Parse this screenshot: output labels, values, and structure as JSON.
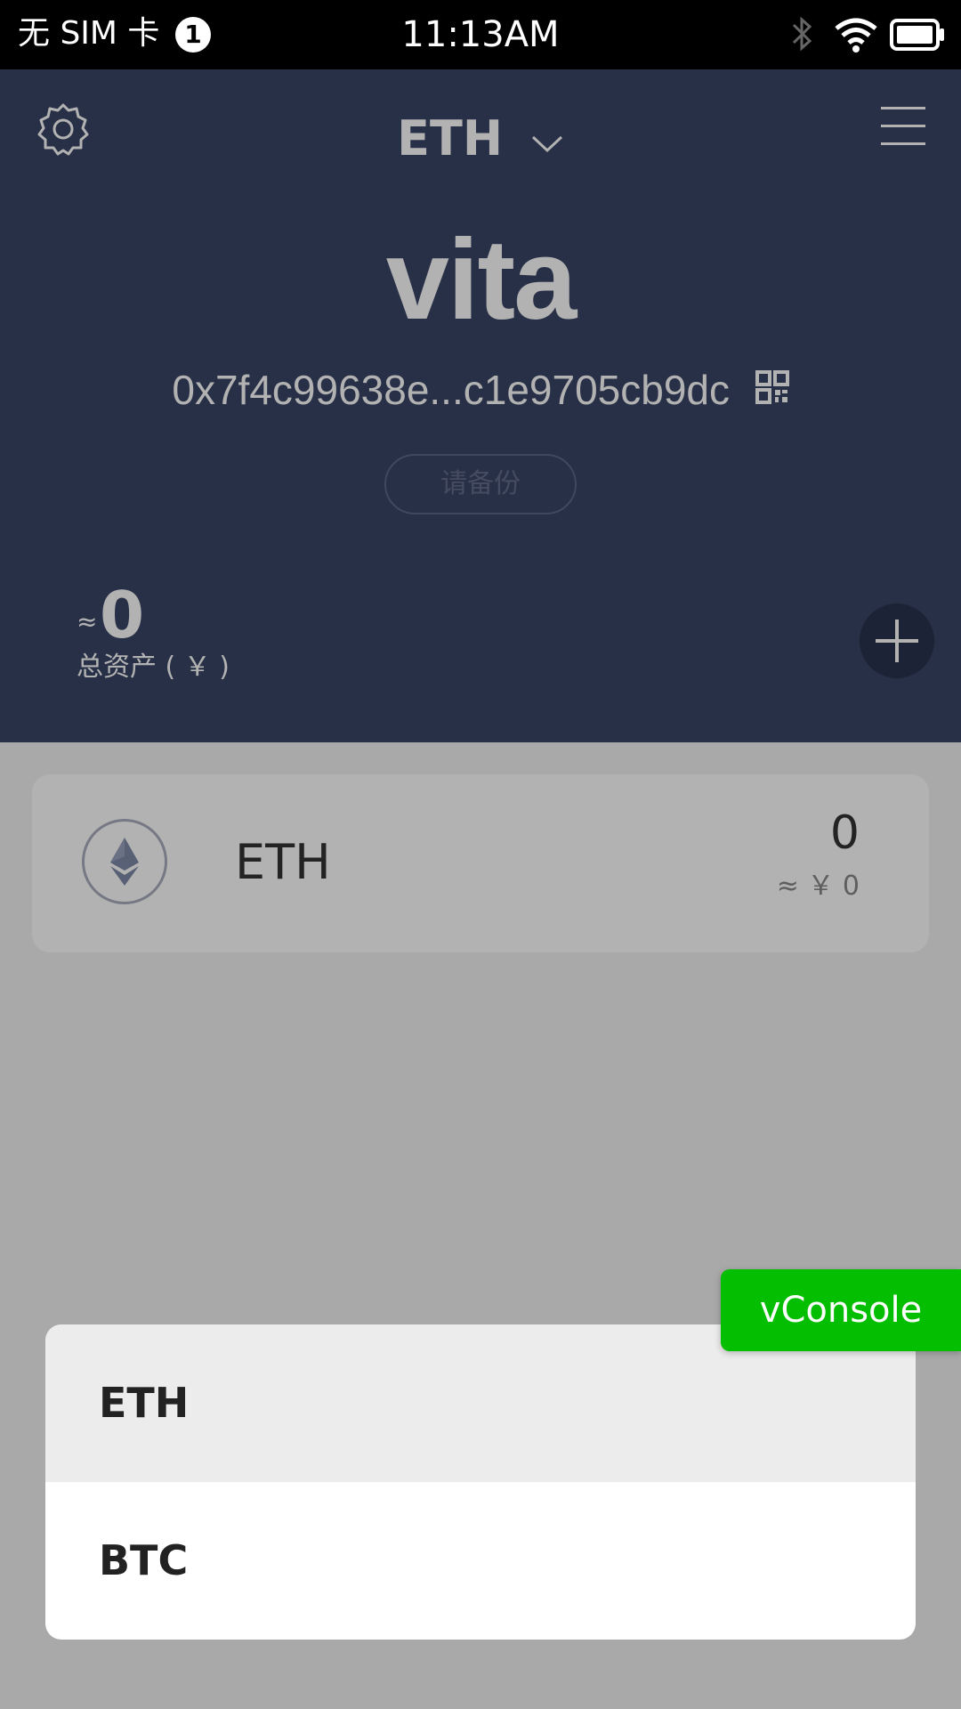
{
  "status_bar": {
    "carrier": "无 SIM 卡",
    "sim_badge": "1",
    "time": "11:13AM",
    "icons": [
      "bluetooth-icon",
      "wifi-icon",
      "battery-icon"
    ]
  },
  "header": {
    "network": "ETH",
    "wallet_name": "vita",
    "address": "0x7f4c99638e...c1e9705cb9dc",
    "backup_label": "请备份",
    "total_prefix": "≈",
    "total_value": "0",
    "total_label": "总资产 ( ￥ )"
  },
  "assets": [
    {
      "symbol": "ETH",
      "amount": "0",
      "fiat": "≈ ￥ 0"
    }
  ],
  "picker": {
    "options": [
      "ETH",
      "BTC"
    ],
    "selected": "ETH"
  },
  "vconsole_label": "vConsole",
  "colors": {
    "header_bg": "#3a4566",
    "page_bg": "#f2f2f2",
    "vconsole_bg": "#04be02"
  }
}
